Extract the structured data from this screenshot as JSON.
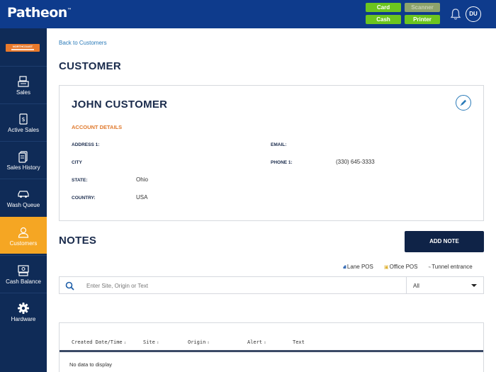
{
  "app": {
    "logo": "Patheon",
    "logo_tm": "™"
  },
  "hardware": {
    "card": "Card",
    "scanner": "Scanner",
    "cash": "Cash",
    "printer": "Printer"
  },
  "user": {
    "initials": "DU"
  },
  "sidebar": {
    "brand": "NORTHCOAST",
    "items": [
      {
        "label": "Sales",
        "icon": "register-icon"
      },
      {
        "label": "Active Sales",
        "icon": "receipt-icon"
      },
      {
        "label": "Sales History",
        "icon": "history-icon"
      },
      {
        "label": "Wash Queue",
        "icon": "car-icon"
      },
      {
        "label": "Customers",
        "icon": "customer-icon",
        "active": true
      },
      {
        "label": "Cash Balance",
        "icon": "cash-register-icon"
      },
      {
        "label": "Hardware",
        "icon": "gear-icon"
      }
    ]
  },
  "main": {
    "back_link": "Back to Customers",
    "title": "CUSTOMER",
    "customer": {
      "name": "JOHN CUSTOMER",
      "section": "ACCOUNT DETAILS",
      "address1_label": "ADDRESS 1:",
      "address1_value": "",
      "city_label": "CITY",
      "city_value": "",
      "state_label": "STATE:",
      "state_value": "Ohio",
      "country_label": "COUNTRY:",
      "country_value": "USA",
      "email_label": "EMAIL:",
      "email_value": "",
      "phone_label": "PHONE 1:",
      "phone_value": "(330) 645-3333"
    },
    "notes": {
      "title": "NOTES",
      "add_button": "ADD NOTE",
      "legend": [
        {
          "label": "Lane POS",
          "color": "#3b6fb6"
        },
        {
          "label": "Office POS",
          "color": "#e0b43a"
        },
        {
          "label": "Tunnel entrance",
          "color": "#8a8a8a"
        }
      ],
      "search_placeholder": "Enter Site, Origin or Text",
      "filter_value": "All",
      "columns": [
        "Created Date/Time",
        "Site",
        "Origin",
        "Alert",
        "Text"
      ],
      "empty_message": "No data to display"
    }
  },
  "colors": {
    "topbar": "#0e3b8c",
    "sidebar": "#0f2b57",
    "active_nav": "#f5a623",
    "hardware_ok": "#6cc51f",
    "accent_orange": "#e07a2e",
    "primary_button": "#0f2347"
  }
}
